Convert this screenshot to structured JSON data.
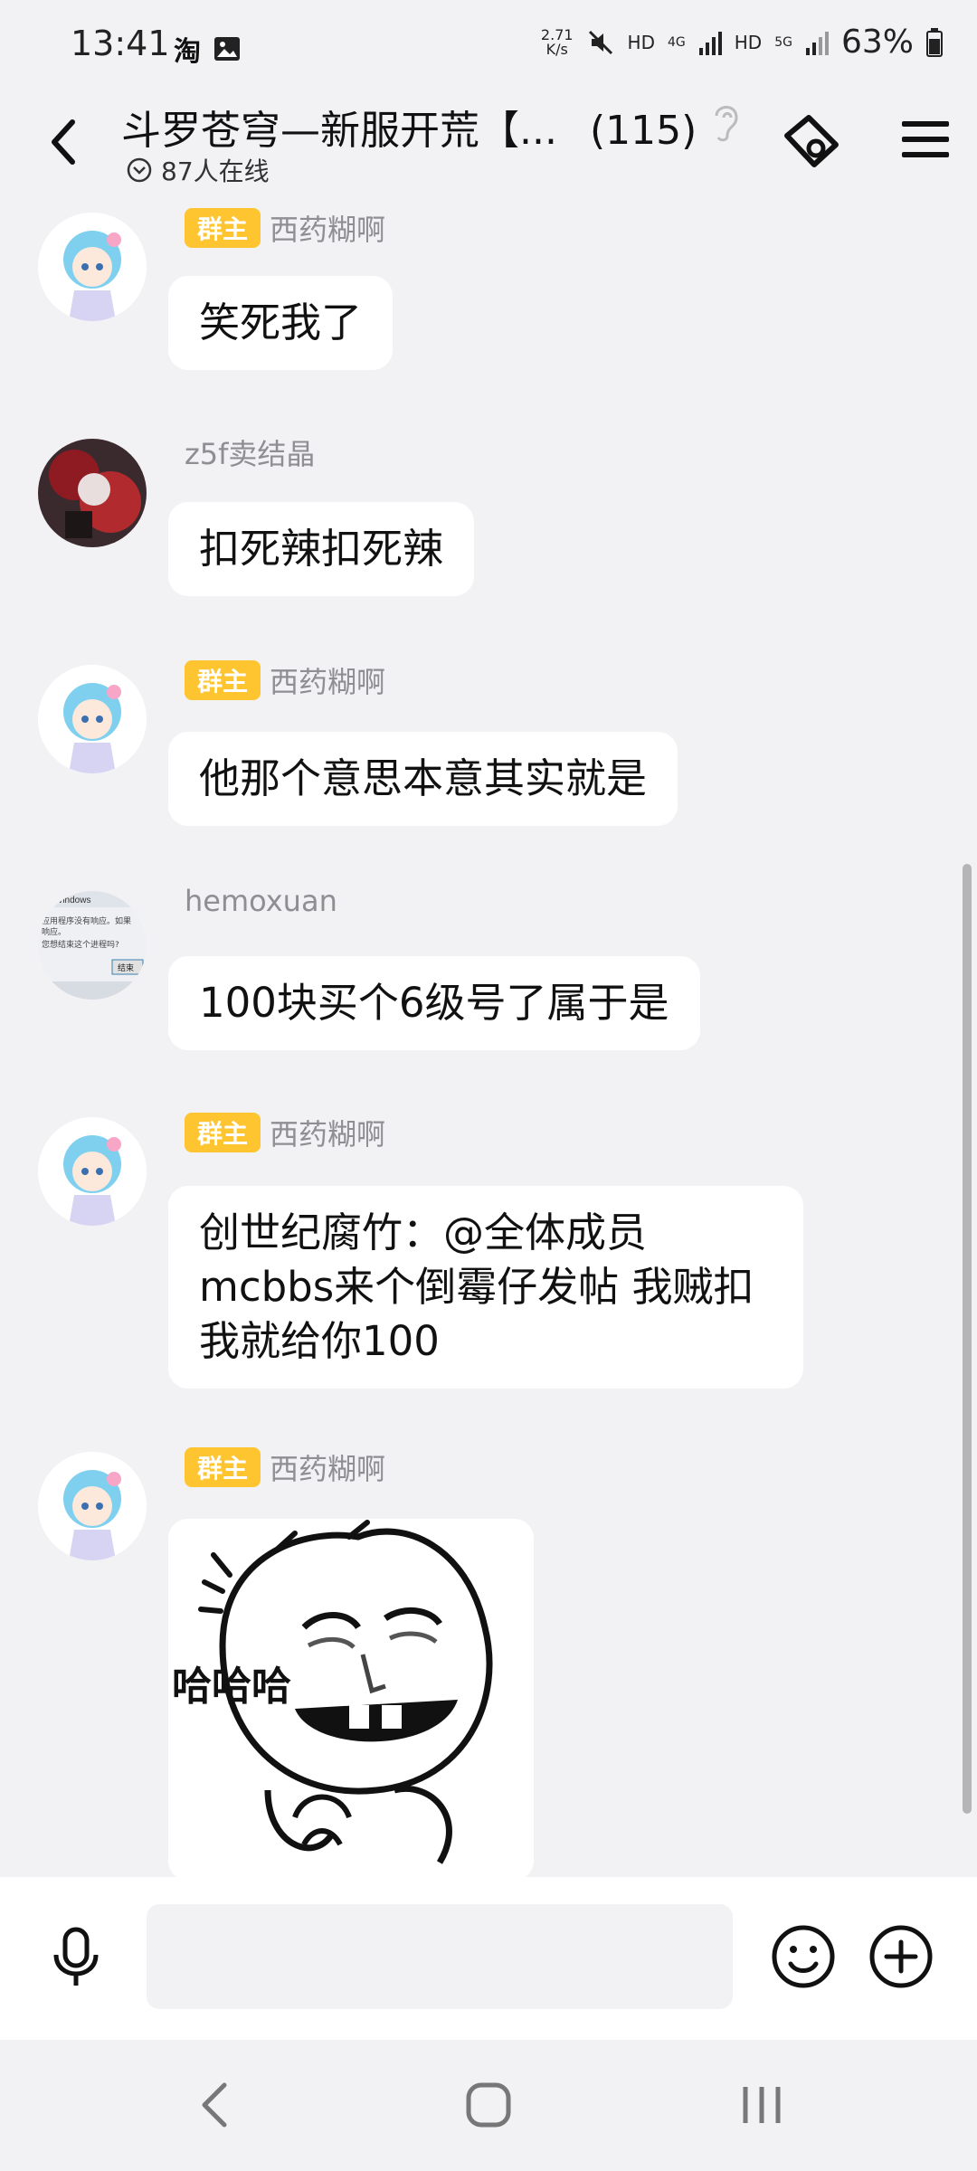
{
  "status_bar": {
    "time": "13:41",
    "speed_value": "2.71",
    "speed_unit": "K/s",
    "network_1": "HD",
    "network_1_type": "4G",
    "network_2": "HD",
    "network_2_type": "5G",
    "battery": "63%"
  },
  "header": {
    "title": "斗罗苍穹—新服开荒【...",
    "member_count": "(115)",
    "online_status": "87人在线"
  },
  "messages": [
    {
      "badge": "群主",
      "sender": "西药糊啊",
      "text": "笑死我了"
    },
    {
      "badge": "",
      "sender": "z5f卖结晶",
      "text": "扣死辣扣死辣"
    },
    {
      "badge": "群主",
      "sender": "西药糊啊",
      "text": "他那个意思本意其实就是"
    },
    {
      "badge": "",
      "sender": "hemoxuan",
      "text": "100块买个6级号了属于是"
    },
    {
      "badge": "群主",
      "sender": "西药糊啊",
      "text": "创世纪腐竹：@全体成员 mcbbs来个倒霉仔发帖 我贼扣 我就给你100"
    },
    {
      "badge": "群主",
      "sender": "西药糊啊",
      "sticker_text": "哈哈哈"
    }
  ],
  "avatar_window": {
    "title": "oft Windows",
    "line1": "应用程序没有响应。如果",
    "line2": "响应。",
    "line3": "您想结束这个进程吗?",
    "button": "结束"
  },
  "input": {
    "placeholder": ""
  },
  "colors": {
    "badge": "#ffc531",
    "background": "#f2f2f4",
    "bubble": "#ffffff"
  }
}
